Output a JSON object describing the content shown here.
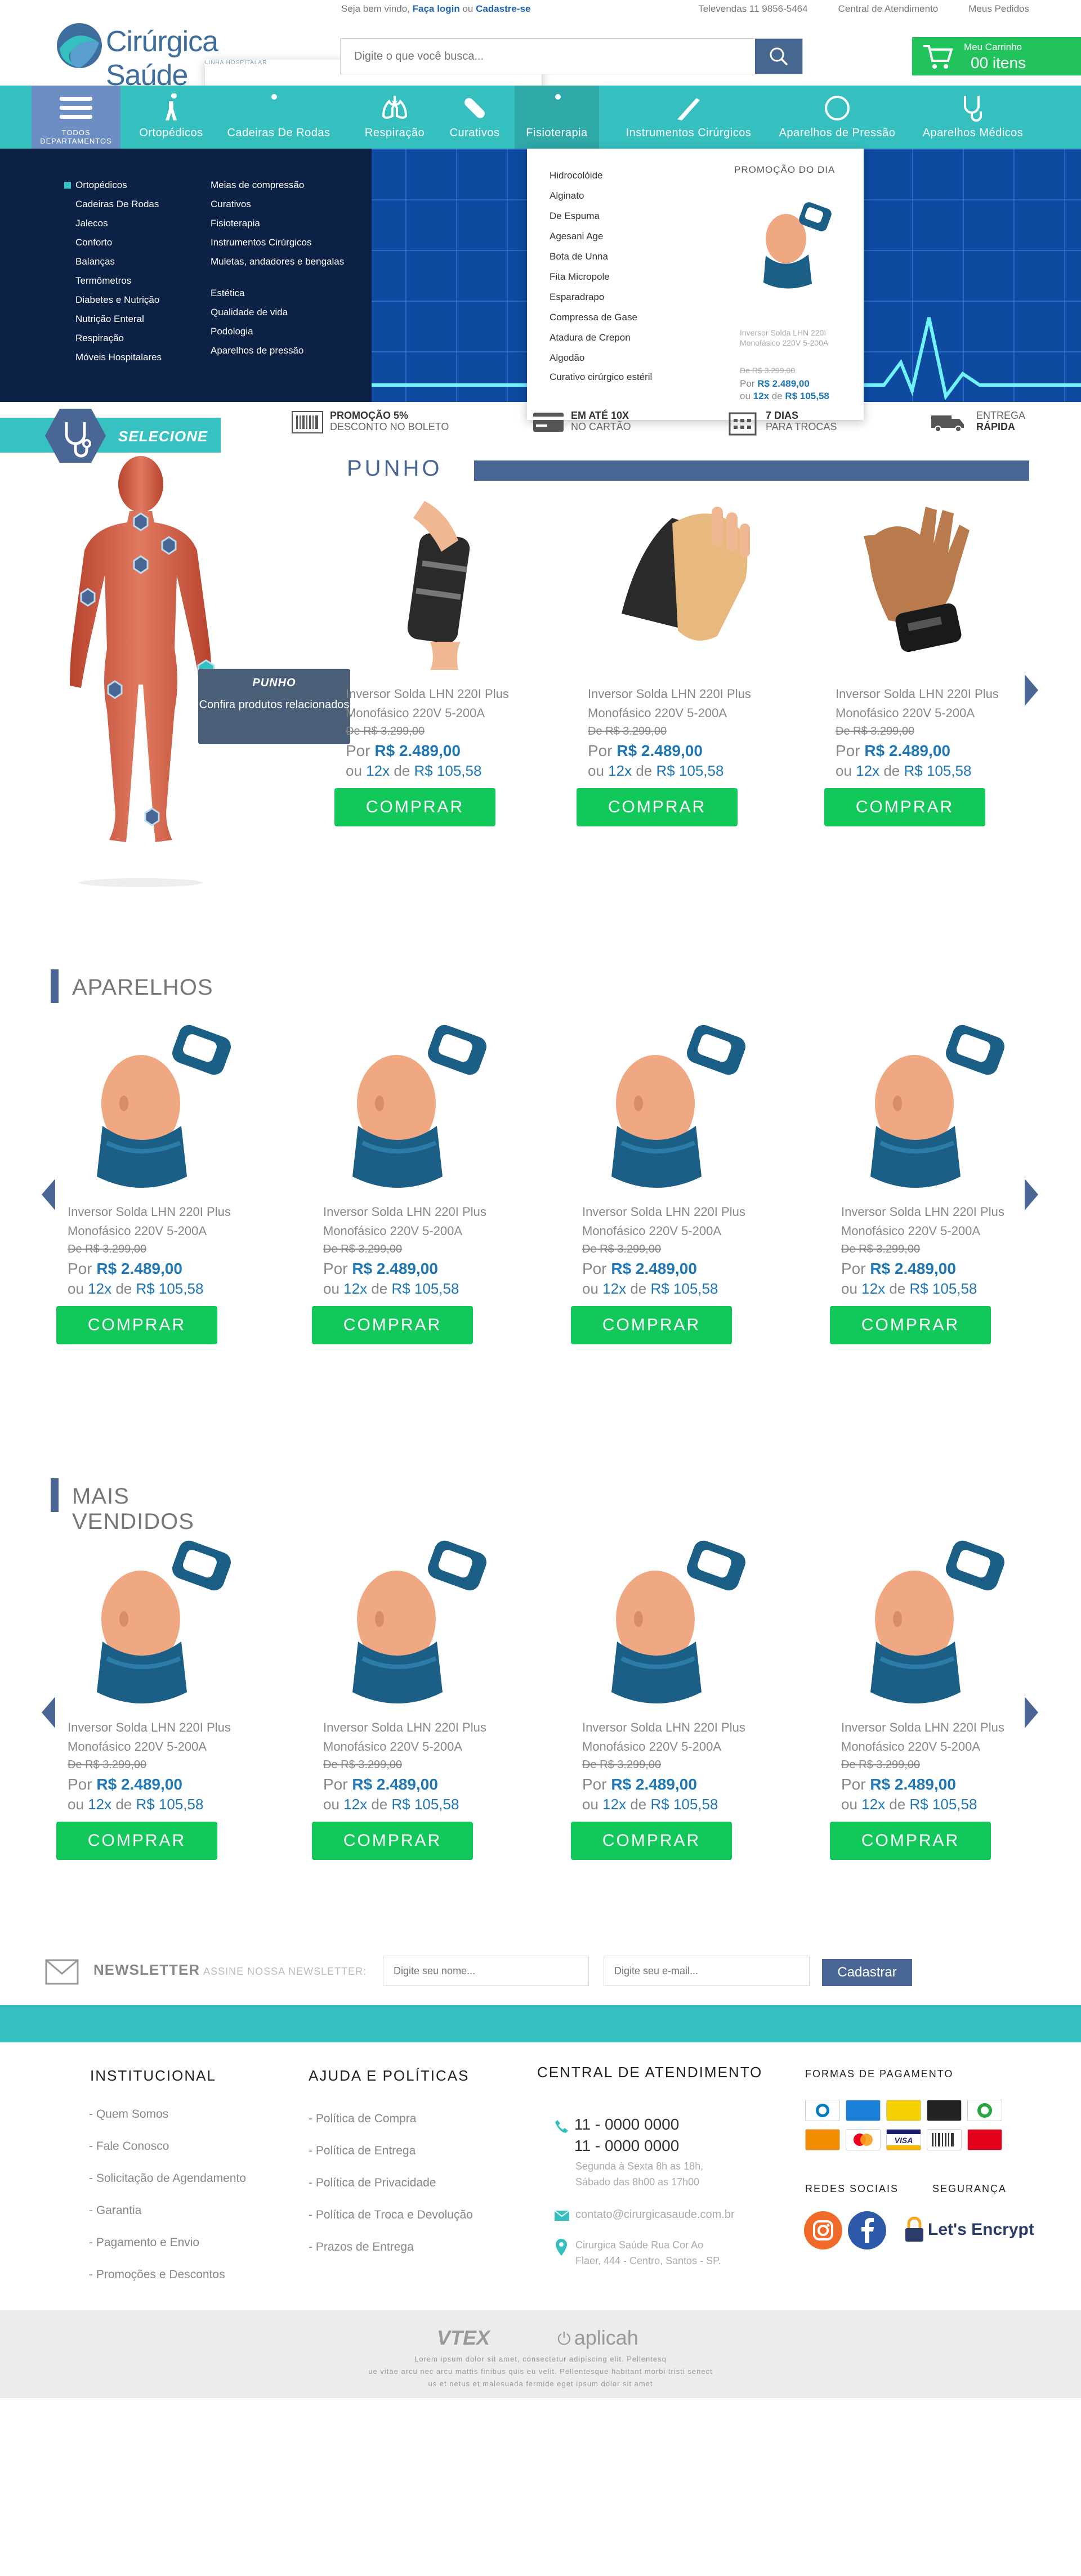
{
  "topbar": {
    "welcome": "Seja bem vindo,",
    "login": "Faça login",
    "or": "ou",
    "signup": "Cadastre-se",
    "televendas": "Televendas 11 9856-5464",
    "central": "Central de Atendimento",
    "pedidos": "Meus Pedidos"
  },
  "logo": {
    "name": "Cirúrgica Saúde",
    "sub": "LINHA HOSPITALAR"
  },
  "search": {
    "placeholder": "Digite o que você busca..."
  },
  "cart": {
    "label": "Meu Carrinho",
    "count": "00 itens"
  },
  "nav": {
    "all": "TODOS DEPARTAMENTOS",
    "items": [
      {
        "label": "Ortopédicos",
        "icon": "orthopedic-icon"
      },
      {
        "label": "Cadeiras De Rodas",
        "icon": "wheelchair-icon"
      },
      {
        "label": "Respiração",
        "icon": "lungs-icon"
      },
      {
        "label": "Curativos",
        "icon": "bandage-icon"
      },
      {
        "label": "Fisioterapia",
        "icon": "physio-icon"
      },
      {
        "label": "Instrumentos Cirúrgicos",
        "icon": "scalpel-icon"
      },
      {
        "label": "Aparelhos de Pressão",
        "icon": "gauge-icon"
      },
      {
        "label": "Aparelhos Médicos",
        "icon": "stethoscope-icon"
      }
    ]
  },
  "mega": {
    "col1": [
      "Ortopédicos",
      "Cadeiras De Rodas",
      "Jalecos",
      "Conforto",
      "Balanças",
      "Termômetros",
      "Diabetes e Nutrição",
      "Nutrição Enteral",
      "Respiração",
      "Móveis Hospitalares"
    ],
    "col2": [
      "Meias de compressão",
      "Curativos",
      "Fisioterapia",
      "Instrumentos Cirúrgicos",
      "Muletas, andadores e bengalas",
      "Estética",
      "Qualidade de vida",
      "Podologia",
      "Aparelhos de pressão"
    ]
  },
  "submenu": {
    "items": [
      "Hidrocolóide",
      "Alginato",
      "De Espuma",
      "Agesani Age",
      "Bota de Unna",
      "Fita Micropole",
      "Esparadrapo",
      "Compressa de Gase",
      "Atadura de Crepon",
      "Algodão",
      "Curativo cirúrgico estéril"
    ],
    "promo_title": "PROMOÇÃO DO DIA",
    "promo_name": "Inversor Solda LHN 220I Monofásico 220V 5-200A",
    "promo_old": "De R$ 3.299,00",
    "promo_por": "Por",
    "promo_price": "R$ 2.489,00",
    "promo_ou": "ou",
    "promo_inst": "12x",
    "promo_de": "de",
    "promo_inst_val": "R$ 105,58"
  },
  "benefits": [
    {
      "bold": "PROMOÇÃO 5%",
      "text": "DESCONTO NO BOLETO",
      "icon": "barcode-icon"
    },
    {
      "bold": "EM ATÉ 10X",
      "text": "NO CARTÃO",
      "icon": "card-icon"
    },
    {
      "bold": "7 DIAS",
      "text": "PARA TROCAS",
      "icon": "calendar-icon"
    },
    {
      "bold": "ENTREGA",
      "text": "RÁPIDA",
      "icon": "truck-icon"
    }
  ],
  "selecione": "SELECIONE",
  "tooltip": {
    "title": "PUNHO",
    "text": "Confira produtos relacionados"
  },
  "punho": {
    "title": "PUNHO",
    "products": [
      {
        "name": "Inversor Solda LHN 220I Plus Monofásico 220V 5-200A",
        "old": "De R$ 3.299,00",
        "por": "Por",
        "price": "R$ 2.489,00",
        "ou": "ou",
        "inst": "12x",
        "de": "de",
        "inst_val": "R$ 105,58",
        "buy": "COMPRAR"
      },
      {
        "name": "Inversor Solda LHN 220I Plus Monofásico 220V 5-200A",
        "old": "De R$ 3.299,00",
        "por": "Por",
        "price": "R$ 2.489,00",
        "ou": "ou",
        "inst": "12x",
        "de": "de",
        "inst_val": "R$ 105,58",
        "buy": "COMPRAR"
      },
      {
        "name": "Inversor Solda LHN 220I Plus Monofásico 220V 5-200A",
        "old": "De R$ 3.299,00",
        "por": "Por",
        "price": "R$ 2.489,00",
        "ou": "ou",
        "inst": "12x",
        "de": "de",
        "inst_val": "R$ 105,58",
        "buy": "COMPRAR"
      }
    ]
  },
  "aparelhos": {
    "title": "APARELHOS",
    "products": [
      {
        "name": "Inversor Solda LHN 220I Plus Monofásico 220V 5-200A",
        "old": "De R$ 3.299,00",
        "por": "Por",
        "price": "R$ 2.489,00",
        "ou": "ou",
        "inst": "12x",
        "de": "de",
        "inst_val": "R$ 105,58",
        "buy": "COMPRAR"
      },
      {
        "name": "Inversor Solda LHN 220I Plus Monofásico 220V 5-200A",
        "old": "De R$ 3.299,00",
        "por": "Por",
        "price": "R$ 2.489,00",
        "ou": "ou",
        "inst": "12x",
        "de": "de",
        "inst_val": "R$ 105,58",
        "buy": "COMPRAR"
      },
      {
        "name": "Inversor Solda LHN 220I Plus Monofásico 220V 5-200A",
        "old": "De R$ 3.299,00",
        "por": "Por",
        "price": "R$ 2.489,00",
        "ou": "ou",
        "inst": "12x",
        "de": "de",
        "inst_val": "R$ 105,58",
        "buy": "COMPRAR"
      },
      {
        "name": "Inversor Solda LHN 220I Plus Monofásico 220V 5-200A",
        "old": "De R$ 3.299,00",
        "por": "Por",
        "price": "R$ 2.489,00",
        "ou": "ou",
        "inst": "12x",
        "de": "de",
        "inst_val": "R$ 105,58",
        "buy": "COMPRAR"
      }
    ]
  },
  "maisvendidos": {
    "title": "MAIS VENDIDOS",
    "products": [
      {
        "name": "Inversor Solda LHN 220I Plus Monofásico 220V 5-200A",
        "old": "De R$ 3.299,00",
        "por": "Por",
        "price": "R$ 2.489,00",
        "ou": "ou",
        "inst": "12x",
        "de": "de",
        "inst_val": "R$ 105,58",
        "buy": "COMPRAR"
      },
      {
        "name": "Inversor Solda LHN 220I Plus Monofásico 220V 5-200A",
        "old": "De R$ 3.299,00",
        "por": "Por",
        "price": "R$ 2.489,00",
        "ou": "ou",
        "inst": "12x",
        "de": "de",
        "inst_val": "R$ 105,58",
        "buy": "COMPRAR"
      },
      {
        "name": "Inversor Solda LHN 220I Plus Monofásico 220V 5-200A",
        "old": "De R$ 3.299,00",
        "por": "Por",
        "price": "R$ 2.489,00",
        "ou": "ou",
        "inst": "12x",
        "de": "de",
        "inst_val": "R$ 105,58",
        "buy": "COMPRAR"
      },
      {
        "name": "Inversor Solda LHN 220I Plus Monofásico 220V 5-200A",
        "old": "De R$ 3.299,00",
        "por": "Por",
        "price": "R$ 2.489,00",
        "ou": "ou",
        "inst": "12x",
        "de": "de",
        "inst_val": "R$ 105,58",
        "buy": "COMPRAR"
      }
    ]
  },
  "newsletter": {
    "title": "NEWSLETTER",
    "sub": "ASSINE NOSSA NEWSLETTER:",
    "name_ph": "Digite seu nome...",
    "email_ph": "Digite seu e-mail...",
    "button": "Cadastrar"
  },
  "footer": {
    "inst_title": "INSTITUCIONAL",
    "inst": [
      "- Quem Somos",
      "- Fale Conosco",
      "- Solicitação de Agendamento",
      "- Garantia",
      "- Pagamento e Envio",
      "- Promoções e Descontos"
    ],
    "ajuda_title": "AJUDA E POLÍTICAS",
    "ajuda": [
      "- Política de Compra",
      "- Política de Entrega",
      "- Política de Privacidade",
      "- Política de Troca e Devolução",
      "- Prazos de Entrega"
    ],
    "central_title": "CENTRAL DE ATENDIMENTO",
    "tel1": "11 - 0000 0000",
    "tel2": "11 - 0000 0000",
    "hours1": "Segunda à Sexta 8h as 18h,",
    "hours2": "Sábado das 8h00 as 17h00",
    "email": "contato@cirurgicasaude.com.br",
    "addr1": "Cirurgica Saúde Rua Cor Ao",
    "addr2": "Flaer, 444 - Centro, Santos - SP.",
    "pay_title": "FORMAS DE PAGAMENTO",
    "social_title": "REDES SOCIAIS",
    "sec_title": "SEGURANÇA",
    "encrypt": "Let's Encrypt"
  },
  "bottom": {
    "vtex": "VTEX",
    "aplicah": "aplicah",
    "line1": "Lorem ipsum dolor sit amet, consectetur adipiscing elit. Pellentesq",
    "line2": "ue vitae arcu nec arcu mattis finibus quis eu velit. Pellentesque habitant morbi tristi senect",
    "line3": "us et netus et malesuada fermide eget ipsum dolor sit amet"
  },
  "colors": {
    "teal": "#35bfbf",
    "navy": "#0b2145",
    "blue": "#4a6694",
    "green": "#12c85a",
    "price": "#1f77b5"
  }
}
